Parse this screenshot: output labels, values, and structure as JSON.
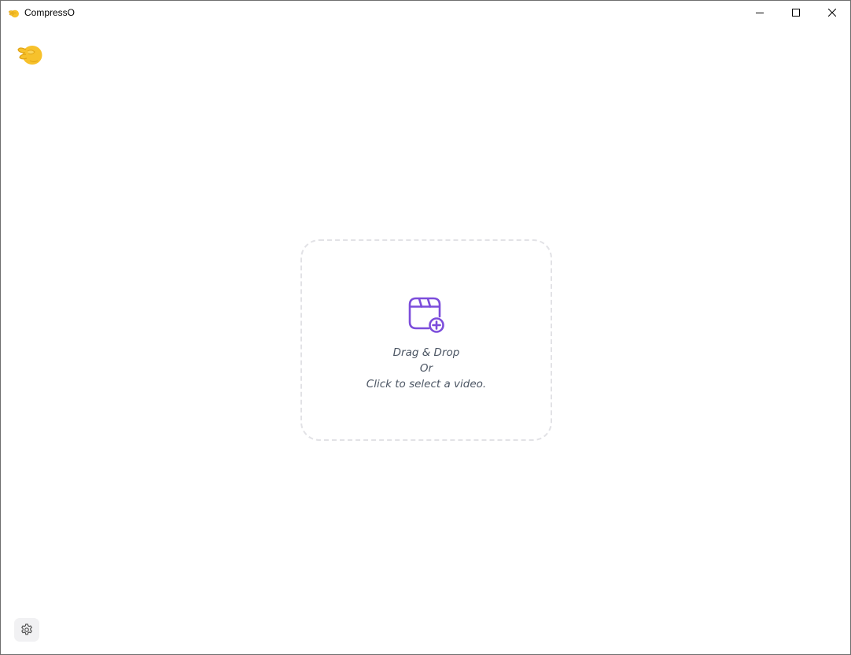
{
  "window": {
    "title": "CompressO",
    "app_icon": "pinching-hand-icon",
    "controls": [
      "minimize-icon",
      "maximize-icon",
      "close-icon"
    ]
  },
  "logo": {
    "icon": "pinching-hand-icon"
  },
  "dropzone": {
    "icon": "video-add-icon",
    "line1": "Drag & Drop",
    "line2": "Or",
    "line3": "Click to select a video."
  },
  "settings": {
    "icon": "gear-icon"
  },
  "colors": {
    "accent": "#7c4ddb",
    "text_muted": "#4b5563",
    "dropzone_border": "#e2e2e6",
    "settings_bg": "#f1f1f3",
    "emoji_yellow": "#f7c12b"
  }
}
